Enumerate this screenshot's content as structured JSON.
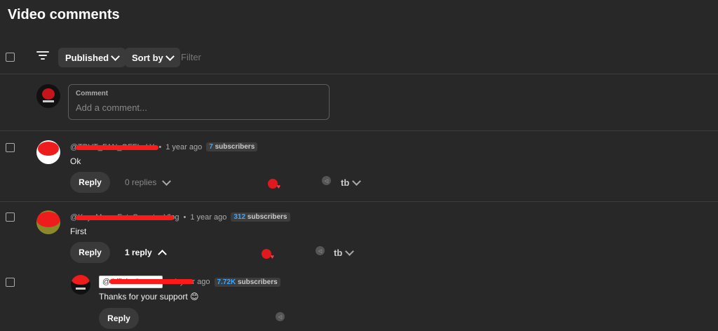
{
  "header": {
    "title": "Video comments"
  },
  "toolbar": {
    "published_label": "Published",
    "sortby_label": "Sort by",
    "filter_placeholder": "Filter"
  },
  "composer": {
    "label": "Comment",
    "placeholder": "Add a comment..."
  },
  "comments": [
    {
      "handle": "@TPUT_FAN_OFFI...LY",
      "time": "1 year ago",
      "subs_count": "7",
      "subs_label": "subscribers",
      "text": "Ok",
      "reply_label": "Reply",
      "replies_label": "0 replies"
    },
    {
      "handle": "@KayaMuraoFataSamataeVlog",
      "time": "1 year ago",
      "subs_count": "312",
      "subs_label": "subscribers",
      "text": "First",
      "reply_label": "Reply",
      "replies_label": "1 reply"
    }
  ],
  "reply": {
    "handle": "@Offici...Games",
    "time": "1 year ago",
    "subs_count": "7.72K",
    "subs_label": "subscribers",
    "text": "Thanks for your support 😊",
    "reply_label": "Reply"
  },
  "separator": "•",
  "icons": {
    "thumbs_text": "tb",
    "heart": "♥",
    "pin": "◁"
  }
}
